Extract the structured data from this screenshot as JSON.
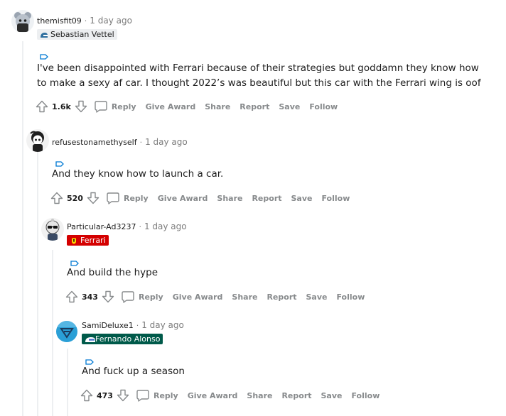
{
  "comments": [
    {
      "username": "themisfit09",
      "time": "1 day ago",
      "flair": "Sebastian Vettel",
      "text": [
        "I've been disappointed with Ferrari because of their strategies but goddamn they know how",
        "to make a sexy af car. I thought 2022’s was beautiful but this car with the Ferrari wing is oof"
      ],
      "score": "1.6k"
    },
    {
      "username": "refusestonamethyself",
      "time": "1 day ago",
      "flair": "",
      "text": [
        "And they know how to launch a car."
      ],
      "score": "520"
    },
    {
      "username": "Particular-Ad3237",
      "time": "1 day ago",
      "flair": "Ferrari",
      "text": [
        "And build the hype"
      ],
      "score": "343"
    },
    {
      "username": "SamiDeluxe1",
      "time": "1 day ago",
      "flair": "Fernando Alonso",
      "text": [
        "And fuck up a season"
      ],
      "score": "473"
    }
  ],
  "actions": {
    "separator": "·",
    "reply": "Reply",
    "give_award": "Give Award",
    "share": "Share",
    "report": "Report",
    "save": "Save",
    "follow": "Follow"
  },
  "colors": {
    "ferrari_flair_bg": "#d40000",
    "alonso_flair_bg": "#005a4a",
    "vettel_flair_bg": "#edeff1",
    "action_gray": "#878a8c",
    "link_blue": "#0079d3"
  },
  "icons": [
    "upvote-icon",
    "downvote-icon",
    "reply-bubble-icon",
    "flair-tag-icon"
  ]
}
